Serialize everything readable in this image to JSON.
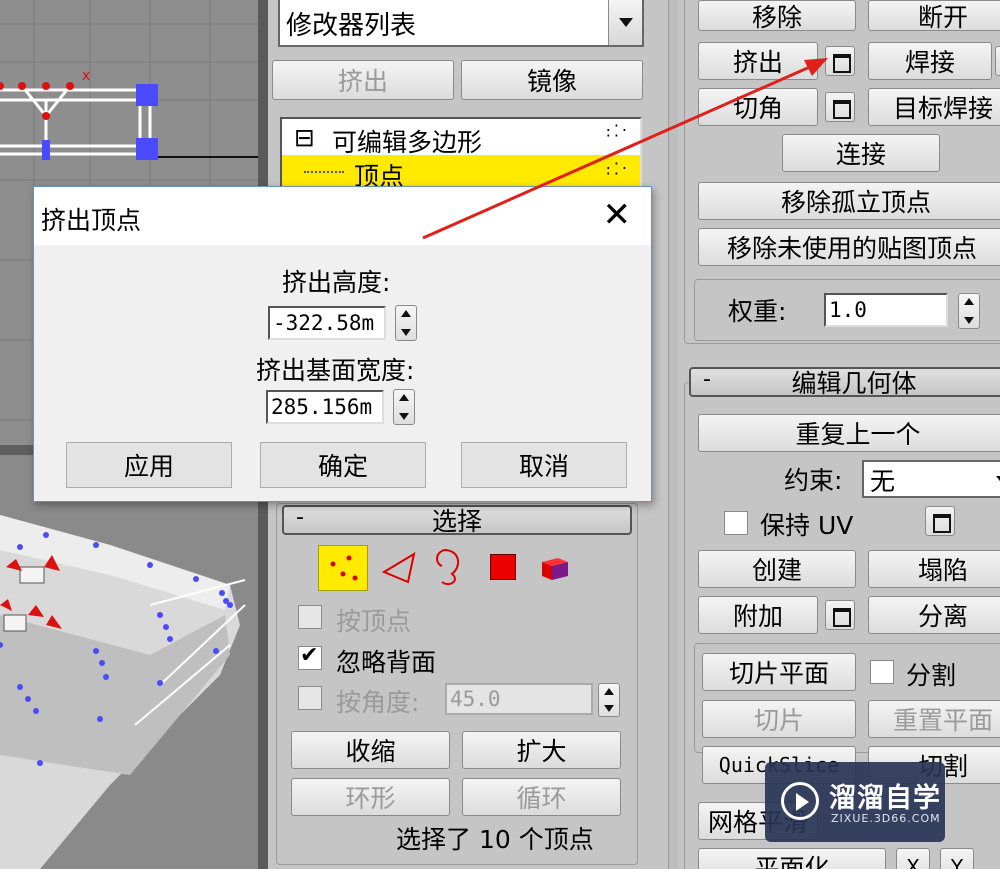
{
  "modifier_panel": {
    "dropdown_label": "修改器列表",
    "extrude_button": "挤出",
    "mirror_button": "镜像",
    "stack": [
      {
        "label": "可编辑多边形",
        "expander": "⊟"
      },
      {
        "label": "顶点"
      }
    ]
  },
  "dialog": {
    "title": "挤出顶点",
    "height_label": "挤出高度:",
    "height_value": "-322.58m",
    "base_width_label": "挤出基面宽度:",
    "base_width_value": "285.156m",
    "apply_button": "应用",
    "ok_button": "确定",
    "cancel_button": "取消"
  },
  "selection_rollout": {
    "title": "选择",
    "by_vertex": "按顶点",
    "ignore_backfacing": "忽略背面",
    "by_angle": "按角度:",
    "angle_value": "45.0",
    "shrink": "收缩",
    "grow": "扩大",
    "ring": "环形",
    "loop": "循环",
    "status": "选择了 10 个顶点"
  },
  "edit_vertices": {
    "remove": "移除",
    "break": "断开",
    "extrude": "挤出",
    "weld": "焊接",
    "chamfer": "切角",
    "target_weld": "目标焊接",
    "connect": "连接",
    "remove_isolated": "移除孤立顶点",
    "remove_unused_map": "移除未使用的贴图顶点",
    "weight_label": "权重:",
    "weight_value": "1.0"
  },
  "edit_geometry": {
    "title": "编辑几何体",
    "repeat_last": "重复上一个",
    "constraints_label": "约束:",
    "constraints_value": "无",
    "preserve_uv": "保持 UV",
    "create": "创建",
    "collapse": "塌陷",
    "attach": "附加",
    "detach": "分离",
    "slice_plane": "切片平面",
    "split": "分割",
    "slice": "切片",
    "reset_plane": "重置平面",
    "quickslice": "QuickSlice",
    "cut": "切割",
    "meshsmooth": "网格平滑",
    "planarize": "平面化",
    "axis_x": "X",
    "axis_y": "Y"
  },
  "watermark": {
    "name": "溜溜自学",
    "url": "ZIXUE.3D66.COM"
  },
  "colors": {
    "selection_yellow": "#ffea00",
    "vertex_blue": "#4a4aff",
    "vertex_red": "#dd1010",
    "annotation_arrow": "#e0201a",
    "dialog_border": "#6f8fb8"
  }
}
